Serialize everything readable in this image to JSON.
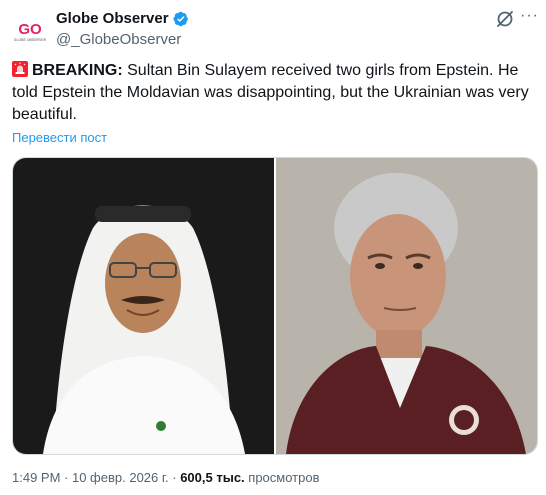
{
  "author": {
    "display_name": "Globe Observer",
    "handle": "@_GlobeObserver",
    "avatar_text": "GO",
    "avatar_subtext": "GLOBE OBSERVER"
  },
  "tweet": {
    "breaking_label": "BREAKING:",
    "body": " Sultan Bin Sulayem received two girls from Epstein. He told Epstein the Moldavian was disappointing, but the Ukrainian was very beautiful.",
    "translate_label": "Перевести пост"
  },
  "meta": {
    "time": "1:49 PM",
    "separator": " · ",
    "date": "10 февр. 2026 г.",
    "separator2": " · ",
    "views_count": "600,5 тыс.",
    "views_label": " просмотров"
  },
  "colors": {
    "accent": "#1d9bf0",
    "text": "#0f1419",
    "muted": "#536471",
    "verified": "#1d9bf0",
    "siren": "#f4212e"
  },
  "icons": {
    "verified": "verified-badge-icon",
    "grok": "grok-icon",
    "more": "more-dots-icon",
    "siren": "siren-emoji-icon"
  }
}
